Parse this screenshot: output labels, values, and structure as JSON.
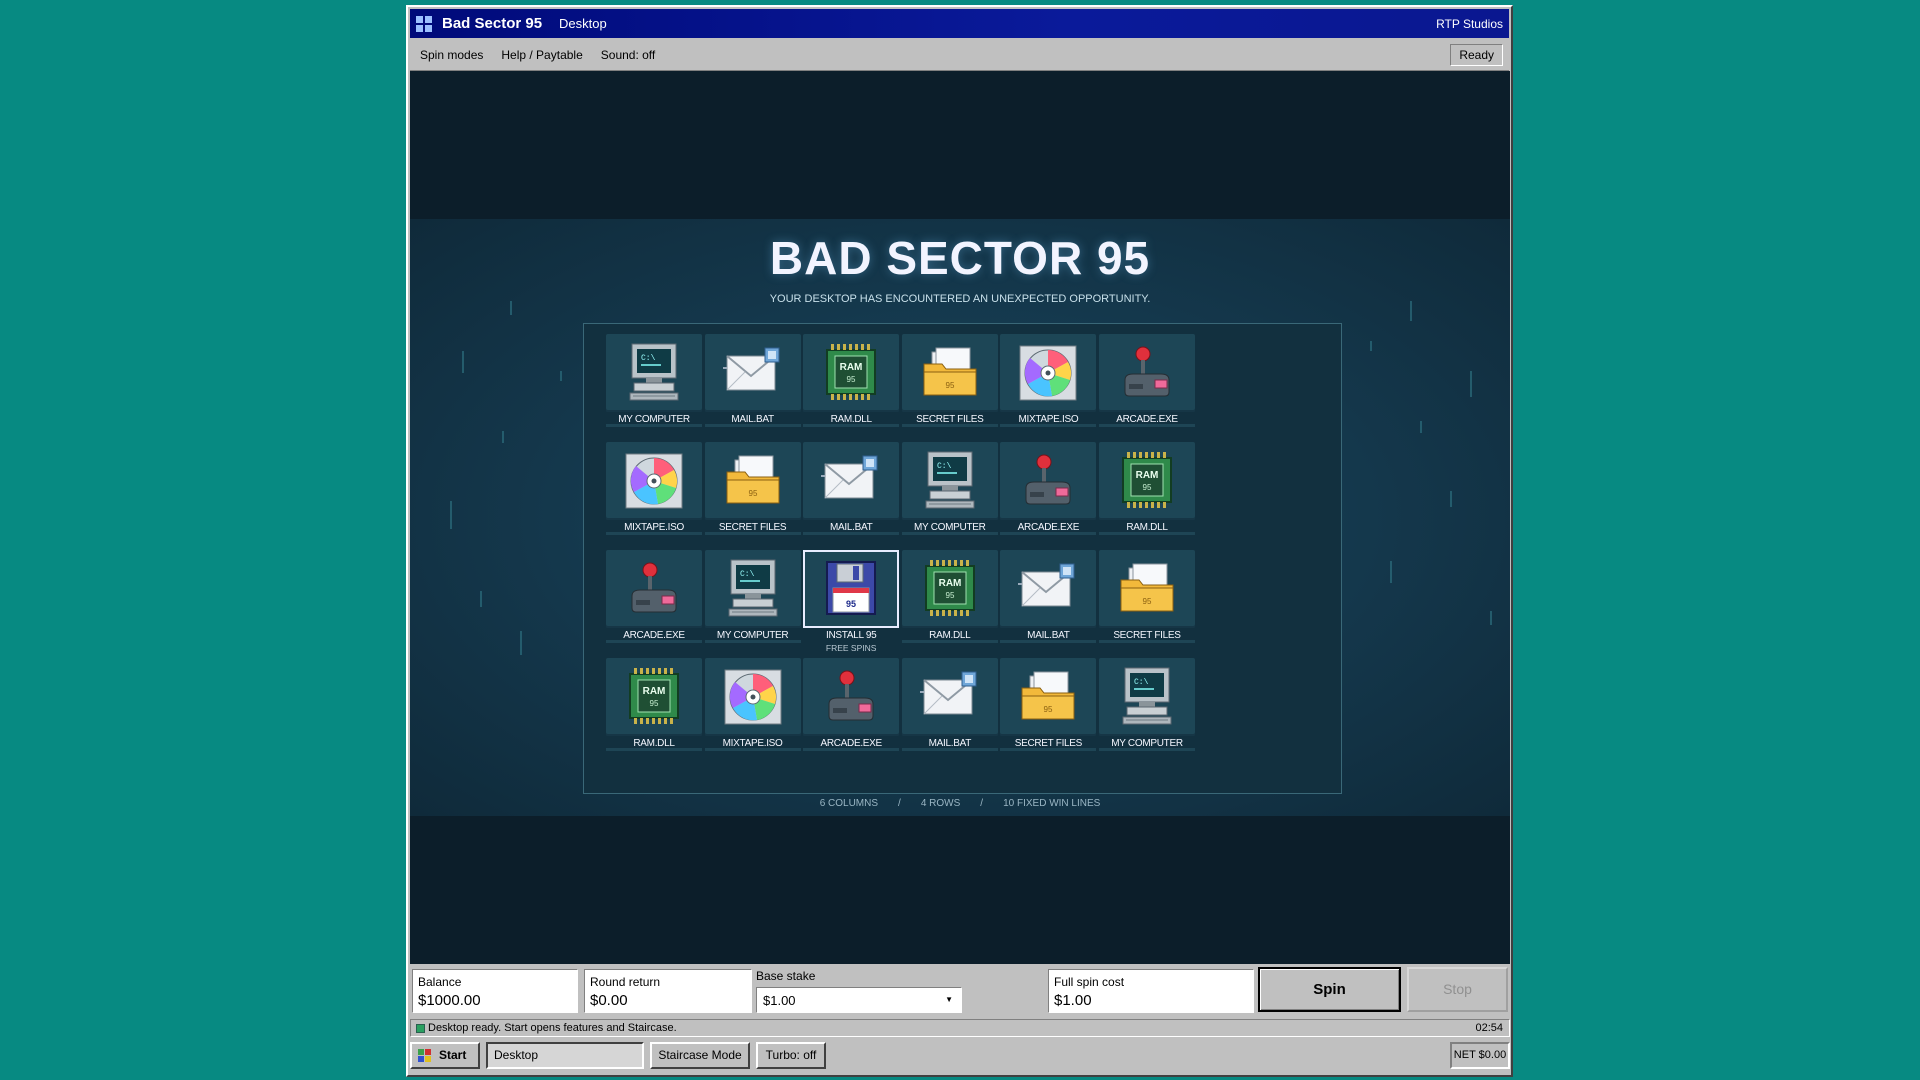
{
  "window": {
    "app_title": "Bad Sector 95",
    "document": "Desktop",
    "publisher": "RTP Studios"
  },
  "menu": {
    "items": [
      "Spin modes",
      "Help / Paytable",
      "Sound: off"
    ],
    "status": "Ready"
  },
  "game": {
    "title": "BAD SECTOR 95",
    "tagline": "YOUR DESKTOP HAS ENCOUNTERED AN UNEXPECTED OPPORTUNITY.",
    "grid": [
      [
        {
          "label": "MY COMPUTER",
          "icon": "computer"
        },
        {
          "label": "MAIL.BAT",
          "icon": "mail"
        },
        {
          "label": "RAM.DLL",
          "icon": "ram"
        },
        {
          "label": "SECRET FILES",
          "icon": "folder"
        },
        {
          "label": "MIXTAPE.ISO",
          "icon": "disc"
        },
        {
          "label": "ARCADE.EXE",
          "icon": "joystick"
        }
      ],
      [
        {
          "label": "MIXTAPE.ISO",
          "icon": "disc"
        },
        {
          "label": "SECRET FILES",
          "icon": "folder"
        },
        {
          "label": "MAIL.BAT",
          "icon": "mail"
        },
        {
          "label": "MY COMPUTER",
          "icon": "computer"
        },
        {
          "label": "ARCADE.EXE",
          "icon": "joystick"
        },
        {
          "label": "RAM.DLL",
          "icon": "ram"
        }
      ],
      [
        {
          "label": "ARCADE.EXE",
          "icon": "joystick"
        },
        {
          "label": "MY COMPUTER",
          "icon": "computer"
        },
        {
          "label": "INSTALL 95",
          "icon": "floppy",
          "sublabel": "FREE SPINS",
          "selected": true
        },
        {
          "label": "RAM.DLL",
          "icon": "ram"
        },
        {
          "label": "MAIL.BAT",
          "icon": "mail"
        },
        {
          "label": "SECRET FILES",
          "icon": "folder"
        }
      ],
      [
        {
          "label": "RAM.DLL",
          "icon": "ram"
        },
        {
          "label": "MIXTAPE.ISO",
          "icon": "disc"
        },
        {
          "label": "ARCADE.EXE",
          "icon": "joystick"
        },
        {
          "label": "MAIL.BAT",
          "icon": "mail"
        },
        {
          "label": "SECRET FILES",
          "icon": "folder"
        },
        {
          "label": "MY COMPUTER",
          "icon": "computer"
        }
      ]
    ],
    "caption": [
      "6 COLUMNS",
      "/",
      "4 ROWS",
      "/",
      "10 FIXED WIN LINES"
    ],
    "ram_text": "RAM",
    "badge_text": "95",
    "prompt_text": "C:\\"
  },
  "controls": {
    "balance_label": "Balance",
    "balance_value": "$1000.00",
    "round_label": "Round return",
    "round_value": "$0.00",
    "stake_label": "Base stake",
    "stake_value": "$1.00",
    "cost_label": "Full spin cost",
    "cost_value": "$1.00",
    "spin_label": "Spin",
    "stop_label": "Stop"
  },
  "status": {
    "message": "Desktop ready. Start opens features and Staircase.",
    "clock": "02:54"
  },
  "taskbar": {
    "start_label": "Start",
    "desktop_label": "Desktop",
    "staircase_label": "Staircase Mode",
    "turbo_label": "Turbo: off",
    "net_label": "NET $0.00"
  },
  "colors": {
    "desktop": "#078a82",
    "titlebar": "#000a7a",
    "stage": "#0c1e2a",
    "tile": "#1d4656",
    "folder": "#f2b93b"
  }
}
